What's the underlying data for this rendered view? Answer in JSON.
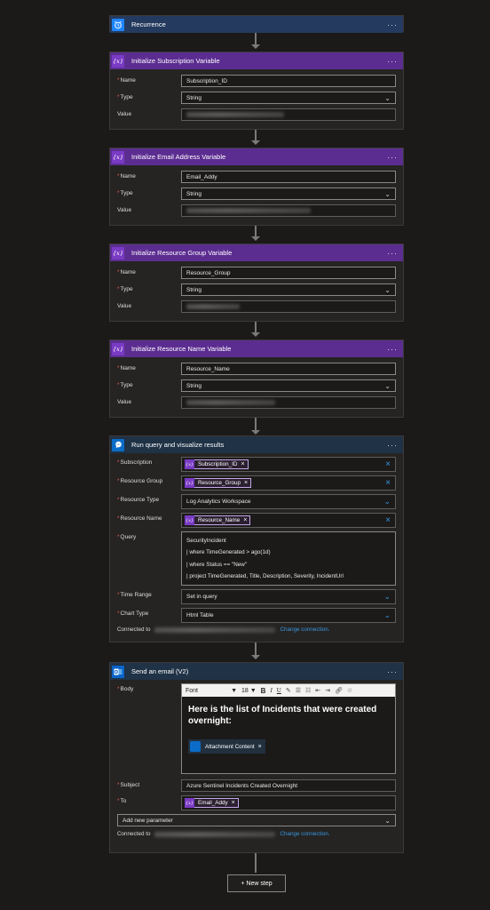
{
  "recurrence": {
    "title": "Recurrence"
  },
  "more": "···",
  "var_icon": "{x}",
  "init1": {
    "title": "Initialize Subscription Variable",
    "name_label": "Name",
    "name_value": "Subscription_ID",
    "type_label": "Type",
    "type_value": "String",
    "value_label": "Value"
  },
  "init2": {
    "title": "Initialize Email Address Variable",
    "name_label": "Name",
    "name_value": "Email_Addy",
    "type_label": "Type",
    "type_value": "String",
    "value_label": "Value"
  },
  "init3": {
    "title": "Initialize Resource Group Variable",
    "name_label": "Name",
    "name_value": "Resource_Group",
    "type_label": "Type",
    "type_value": "String",
    "value_label": "Value"
  },
  "init4": {
    "title": "Initialize Resource Name Variable",
    "name_label": "Name",
    "name_value": "Resource_Name",
    "type_label": "Type",
    "type_value": "String",
    "value_label": "Value"
  },
  "query": {
    "title": "Run query and visualize results",
    "subscription_label": "Subscription",
    "subscription_token": "Subscription_ID",
    "rg_label": "Resource Group",
    "rg_token": "Resource_Group",
    "rtype_label": "Resource Type",
    "rtype_value": "Log Analytics Workspace",
    "rname_label": "Resource Name",
    "rname_token": "Resource_Name",
    "query_label": "Query",
    "query_lines": [
      "SecurityIncident",
      "| where TimeGenerated > ago(1d)",
      "| where Status == \"New\"",
      "| project TimeGenerated, Title, Description, Severity, IncidentUrl"
    ],
    "time_label": "Time Range",
    "time_value": "Set in query",
    "chart_label": "Chart Type",
    "chart_value": "Html Table",
    "connected": "Connected to",
    "change": "Change connection."
  },
  "email": {
    "title": "Send an email (V2)",
    "body_label": "Body",
    "font": "Font",
    "size": "18",
    "heading": "Here is the list of Incidents that were created overnight:",
    "attachment": "Attachment Content",
    "subject_label": "Subject",
    "subject_value": "Azure Sentinel Incidents Created Overnight",
    "to_label": "To",
    "to_token": "Email_Addy",
    "add_param": "Add new parameter",
    "connected": "Connected to",
    "change": "Change connection."
  },
  "new_step": "+ New step"
}
